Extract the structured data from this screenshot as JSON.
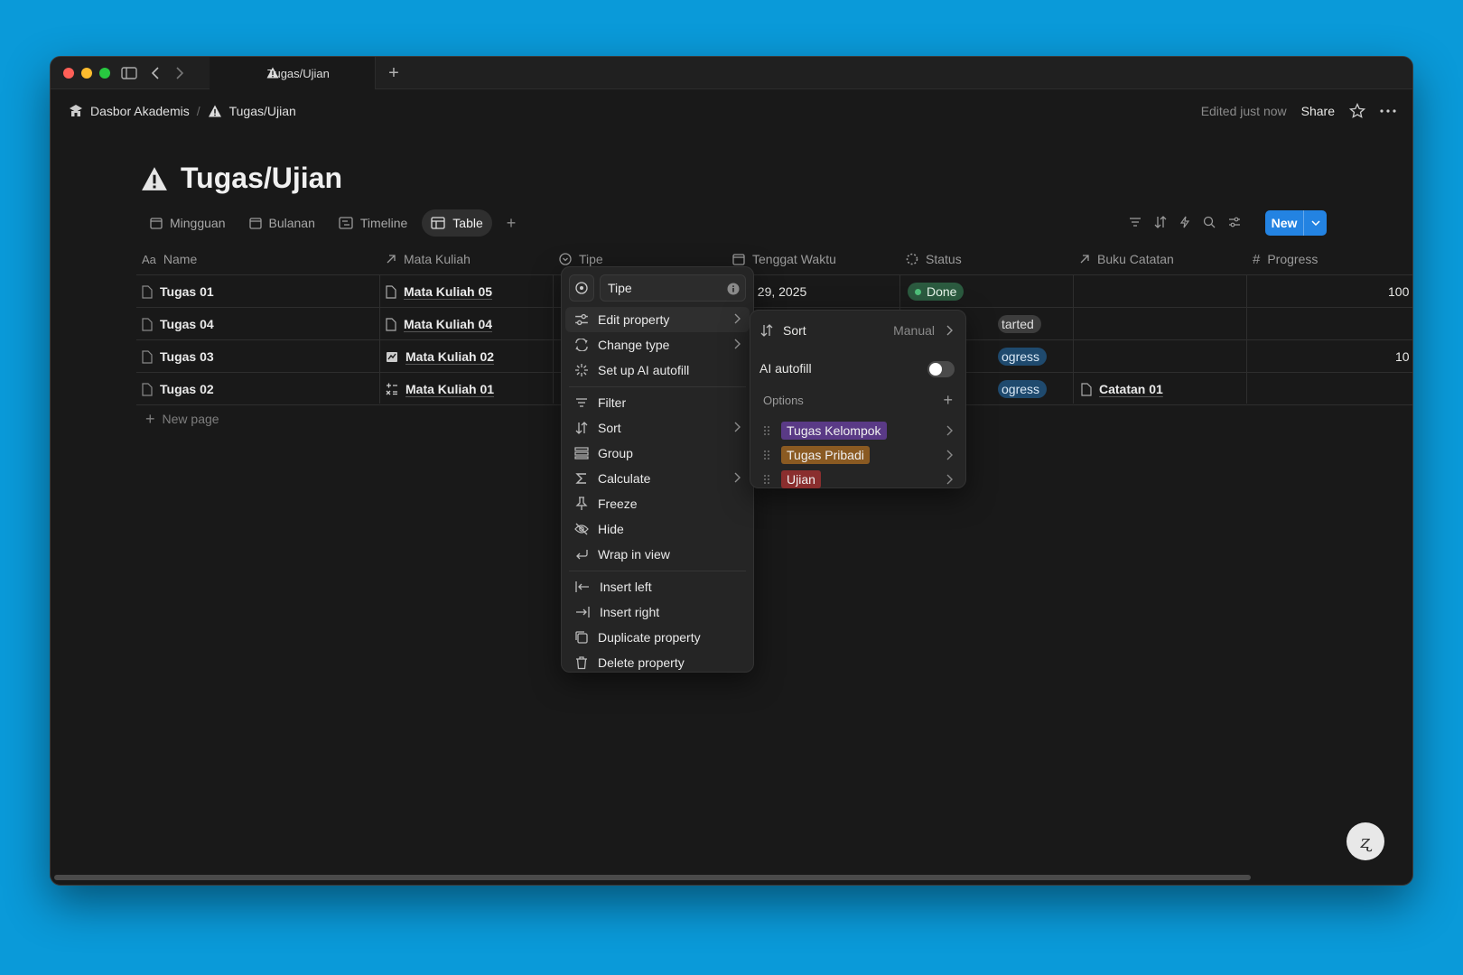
{
  "window": {
    "tab_title": "Tugas/Ujian",
    "breadcrumb": [
      {
        "label": "Dasbor Akademis",
        "icon": "graduation-icon"
      },
      {
        "label": "Tugas/Ujian",
        "icon": "warning-icon"
      }
    ],
    "edited": "Edited just now",
    "share": "Share"
  },
  "page": {
    "title": "Tugas/Ujian",
    "views": [
      "Mingguan",
      "Bulanan",
      "Timeline",
      "Table"
    ],
    "active_view": "Table",
    "new_label": "New"
  },
  "table": {
    "columns": [
      {
        "label": "Name",
        "icon": "Aa"
      },
      {
        "label": "Mata Kuliah",
        "icon": "relation-icon"
      },
      {
        "label": "Tipe",
        "icon": "select-icon"
      },
      {
        "label": "Tenggat Waktu",
        "icon": "calendar-icon"
      },
      {
        "label": "Status",
        "icon": "status-icon"
      },
      {
        "label": "Buku Catatan",
        "icon": "relation-icon"
      },
      {
        "label": "Progress",
        "icon": "#"
      }
    ],
    "rows": [
      {
        "name": "Tugas 01",
        "mata_kuliah": "Mata Kuliah 05",
        "tenggat": "uly 29, 2025",
        "status": "Done",
        "buku": "",
        "progress": "100"
      },
      {
        "name": "Tugas 04",
        "mata_kuliah": "Mata Kuliah 04",
        "tenggat": "",
        "status": "tarted",
        "buku": "",
        "progress": ""
      },
      {
        "name": "Tugas 03",
        "mata_kuliah": "Mata Kuliah 02",
        "tenggat": "",
        "status": "ogress",
        "buku": "",
        "progress": "10"
      },
      {
        "name": "Tugas 02",
        "mata_kuliah": "Mata Kuliah 01",
        "tenggat": "",
        "status": "ogress",
        "buku": "Catatan 01",
        "progress": ""
      }
    ],
    "new_page": "New page"
  },
  "menu": {
    "property_name": "Tipe",
    "items": [
      "Edit property",
      "Change type",
      "Set up AI autofill",
      "Filter",
      "Sort",
      "Group",
      "Calculate",
      "Freeze",
      "Hide",
      "Wrap in view",
      "Insert left",
      "Insert right",
      "Duplicate property",
      "Delete property"
    ]
  },
  "submenu": {
    "sort_label": "Sort",
    "sort_value": "Manual",
    "ai_autofill": "AI autofill",
    "ai_autofill_on": false,
    "options_label": "Options",
    "options": [
      {
        "label": "Tugas Kelompok",
        "color": "#5a3a86"
      },
      {
        "label": "Tugas Pribadi",
        "color": "#8a5a22"
      },
      {
        "label": "Ujian",
        "color": "#8a2e2e"
      }
    ]
  },
  "colors": {
    "accent": "#2383e2",
    "done": "#2b5a3f",
    "not_started": "#3d3d3d",
    "in_progress": "#1f4a6e"
  }
}
